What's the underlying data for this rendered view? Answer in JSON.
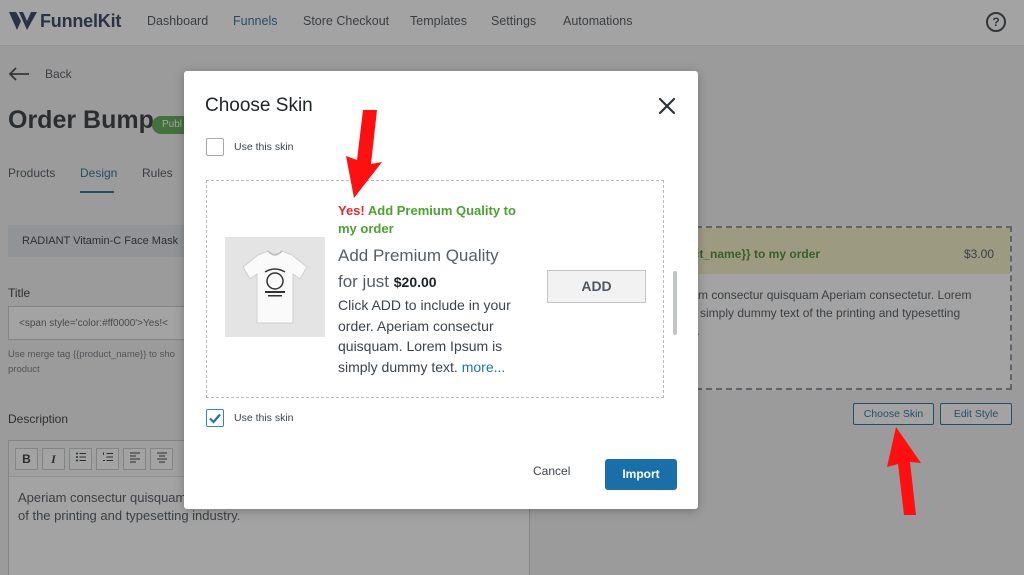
{
  "header": {
    "brand": "FunnelKit",
    "nav": [
      {
        "label": "Dashboard",
        "active": false
      },
      {
        "label": "Funnels",
        "active": true
      },
      {
        "label": "Store Checkout",
        "active": false
      },
      {
        "label": "Templates",
        "active": false
      },
      {
        "label": "Settings",
        "active": false
      },
      {
        "label": "Automations",
        "active": false
      }
    ],
    "help_glyph": "?"
  },
  "page": {
    "back_label": "Back",
    "title": "Order Bump",
    "status_badge": "Publ",
    "tabs": [
      {
        "label": "Products",
        "active": false
      },
      {
        "label": "Design",
        "active": true
      },
      {
        "label": "Rules",
        "active": false
      }
    ],
    "product_chip": "RADIANT Vitamin-C Face Mask",
    "title_label": "Title",
    "title_value": "<span style='color:#ff0000'>Yes!<",
    "title_help": "Use merge tag {{product_name}} to sho product",
    "description_label": "Description",
    "editor_text": "Aperiam consectur quisquam ... of the printing and typesetting industry.",
    "editor_line1": "Aperiam consectur quisquam",
    "editor_line2": "of the printing and typesetting industry.",
    "toolbar": [
      "B",
      "I"
    ]
  },
  "preview": {
    "headline": "duct_name}} to my order",
    "price": "$3.00",
    "body": "eriam consectur quisquam Aperiam consectetur. Lorem n is simply dummy text of the printing and typesetting stry.",
    "body_line1": "eriam consectur quisquam Aperiam consectetur. Lorem",
    "body_line2": "n is simply dummy text of the printing and typesetting",
    "body_line3": "stry.",
    "choose_skin_button": "Choose Skin",
    "edit_style_button": "Edit Style"
  },
  "modal": {
    "title": "Choose Skin",
    "top_checkbox_label": "Use this skin",
    "top_checkbox_checked": false,
    "skin": {
      "headline_yes": "Yes!",
      "headline_rest": " Add Premium Quality to my order",
      "subheading_1": "Add Premium Quality",
      "subheading_2_prefix": "for just",
      "price": "$20.00",
      "description": "Click ADD to include in your order. Aperiam consectur quisquam. Lorem Ipsum is simply dummy text.",
      "more_link": "more...",
      "add_button": "ADD"
    },
    "bottom_checkbox_label": "Use this skin",
    "bottom_checkbox_checked": true,
    "cancel_button": "Cancel",
    "import_button": "Import"
  },
  "colors": {
    "accent": "#1a6fa8",
    "success_green": "#46a33c",
    "headline_green": "#4ca22f",
    "yes_red": "#e12a2a",
    "annotation_arrow": "#ff1010"
  },
  "icons": {
    "logo": "funnelkit-logo-icon",
    "help": "help-circle-icon",
    "back": "arrow-left-icon",
    "close": "close-icon",
    "check": "checkmark-icon",
    "product": "tshirt-icon"
  }
}
